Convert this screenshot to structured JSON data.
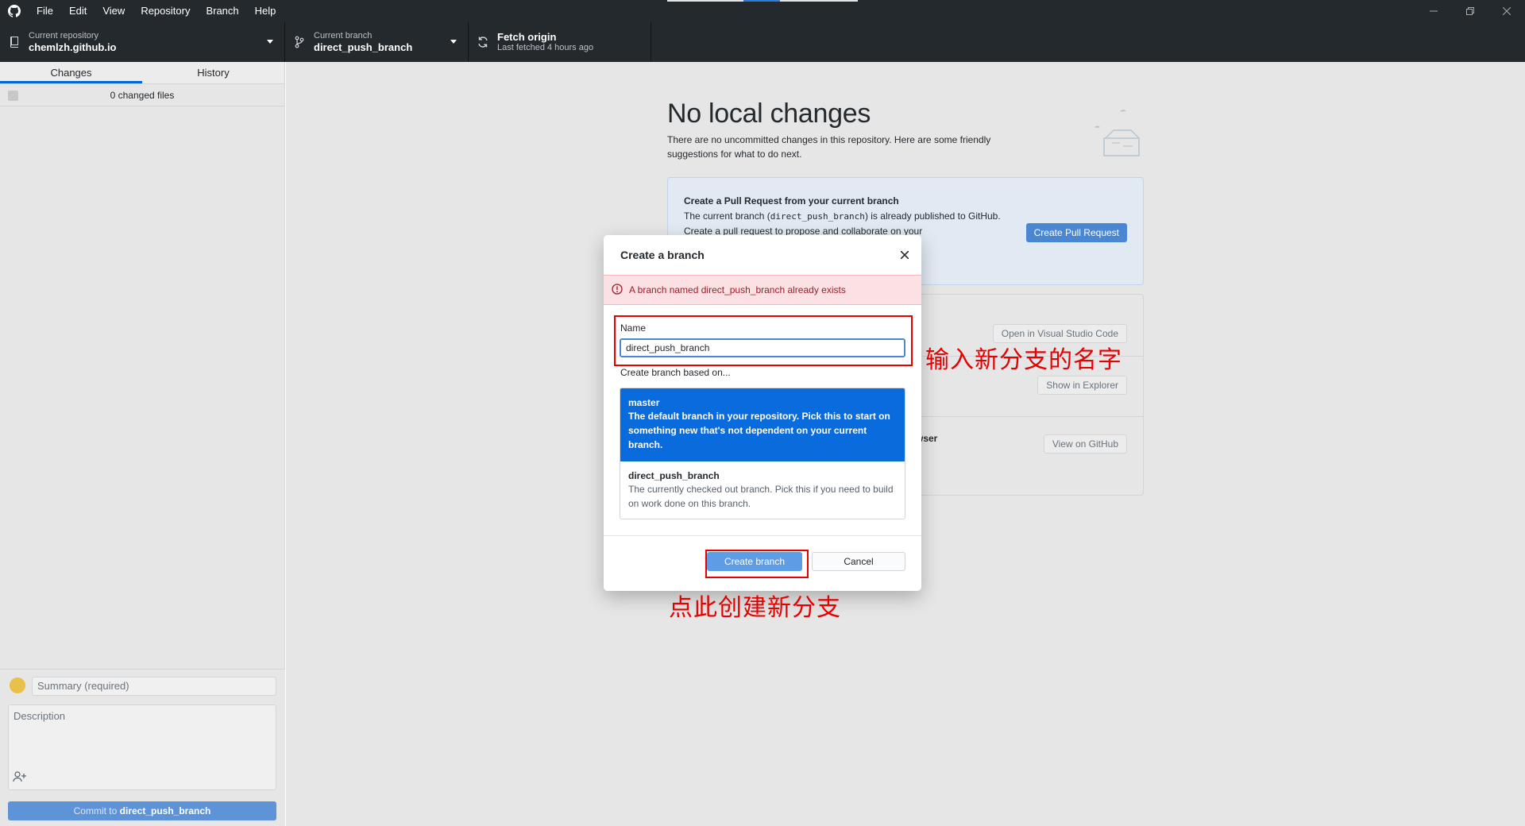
{
  "menu": {
    "items": [
      "File",
      "Edit",
      "View",
      "Repository",
      "Branch",
      "Help"
    ]
  },
  "toolbar": {
    "repo": {
      "label": "Current repository",
      "value": "chemlzh.github.io",
      "icon": "repo-icon"
    },
    "branch": {
      "label": "Current branch",
      "value": "direct_push_branch",
      "icon": "branch-icon"
    },
    "fetch": {
      "label": "Fetch origin",
      "status": "Last fetched 4 hours ago",
      "icon": "sync-icon"
    }
  },
  "sidebar": {
    "tabs": [
      {
        "label": "Changes",
        "active": true
      },
      {
        "label": "History",
        "active": false
      }
    ],
    "changed_files": "0 changed files",
    "commit": {
      "summary_placeholder": "Summary (required)",
      "description_placeholder": "Description",
      "button_prefix": "Commit to ",
      "button_branch": "direct_push_branch"
    }
  },
  "main": {
    "heading": "No local changes",
    "lede": "There are no uncommitted changes in this repository. Here are some friendly suggestions for what to do next.",
    "pull_request": {
      "title": "Create a Pull Request from your current branch",
      "body_before": "The current branch (",
      "body_code": "direct_push_branch",
      "body_after": ") is already published to GitHub. Create a pull request to propose and collaborate on your",
      "button": "Create Pull Request"
    },
    "actions": {
      "editor_button": "Open in Visual Studio Code",
      "explorer_button": "Show in Explorer",
      "browser_title_fragment": "wser",
      "github_button": "View on GitHub"
    }
  },
  "dialog": {
    "title": "Create a branch",
    "error": "A branch named direct_push_branch already exists",
    "name_label": "Name",
    "name_value": "direct_push_branch",
    "based_on_label": "Create branch based on...",
    "options": [
      {
        "name": "master",
        "description": "The default branch in your repository. Pick this to start on something new that's not dependent on your current branch.",
        "selected": true
      },
      {
        "name": "direct_push_branch",
        "description": "The currently checked out branch. Pick this if you need to build on work done on this branch.",
        "selected": false
      }
    ],
    "create_button": "Create branch",
    "cancel_button": "Cancel"
  },
  "annotations": {
    "name_hint": "输入新分支的名字",
    "create_hint": "点此创建新分支",
    "color": "#e60000"
  },
  "colors": {
    "titlebar": "#24292e",
    "accent": "#0a6bdc",
    "error_bg": "#fbe1e3"
  }
}
